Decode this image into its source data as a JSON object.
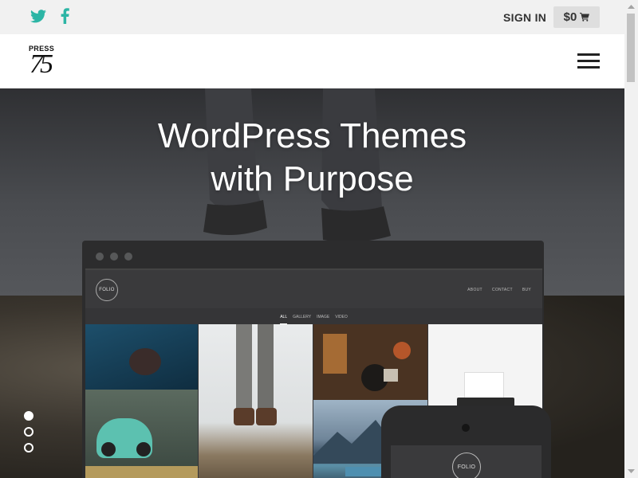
{
  "topbar": {
    "social": [
      {
        "icon": "twitter-icon"
      },
      {
        "icon": "facebook-icon"
      }
    ],
    "signin_label": "SIGN IN",
    "cart_total": "$0",
    "cart_icon": "cart-icon",
    "accent_color": "#2cb5a5"
  },
  "header": {
    "logo_word": "PRESS",
    "logo_number": "75",
    "menu_icon": "hamburger-menu-icon"
  },
  "hero": {
    "title_line1": "WordPress Themes",
    "title_line2": "with Purpose",
    "slides": [
      {
        "active": true
      },
      {
        "active": false
      },
      {
        "active": false
      }
    ]
  },
  "mockup": {
    "folio_logo": "FOLIO",
    "nav": [
      "ABOUT",
      "CONTACT",
      "BUY"
    ],
    "filters": [
      "ALL",
      "GALLERY",
      "IMAGE",
      "VIDEO"
    ]
  },
  "phone": {
    "logo": "FOLIO"
  }
}
